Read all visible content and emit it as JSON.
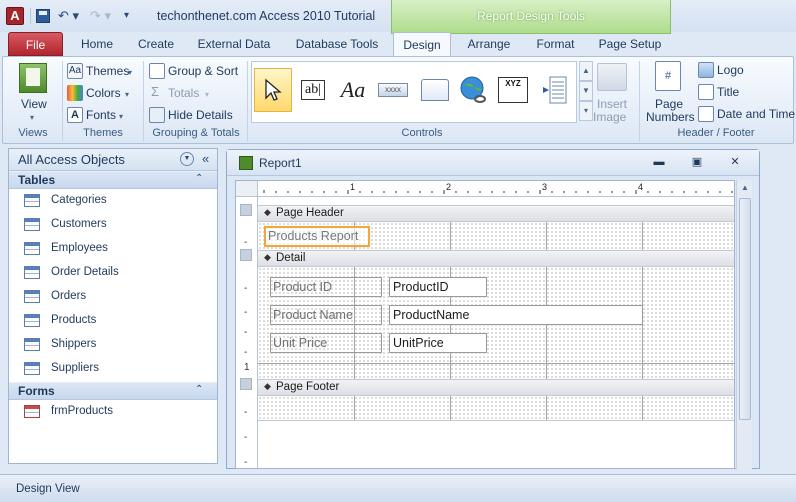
{
  "window": {
    "title": "techonthenet.com Access 2010 Tutorial",
    "app_icon": "A"
  },
  "context_tab": {
    "title": "Report Design Tools"
  },
  "tabs": [
    "File",
    "Home",
    "Create",
    "External Data",
    "Database Tools",
    "Design",
    "Arrange",
    "Format",
    "Page Setup"
  ],
  "ribbon": {
    "views": {
      "button": "View",
      "label": "Views"
    },
    "themes": {
      "themes": "Themes",
      "colors": "Colors",
      "fonts": "Fonts",
      "label": "Themes"
    },
    "grouping": {
      "group_sort": "Group & Sort",
      "totals": "Totals",
      "hide_details": "Hide Details",
      "label": "Grouping & Totals"
    },
    "controls": {
      "label": "Controls",
      "textbox_glyph": "ab|",
      "label_glyph": "Aa",
      "button_glyph": "xxxx",
      "option_glyph": "XYZ"
    },
    "insert_image": {
      "line1": "Insert",
      "line2": "Image"
    },
    "header_footer": {
      "page_numbers_1": "Page",
      "page_numbers_2": "Numbers",
      "page_numbers_glyph": "#",
      "logo": "Logo",
      "title": "Title",
      "date_time": "Date and Time",
      "label": "Header / Footer"
    }
  },
  "nav": {
    "title": "All Access Objects",
    "tables_header": "Tables",
    "tables": [
      "Categories",
      "Customers",
      "Employees",
      "Order Details",
      "Orders",
      "Products",
      "Shippers",
      "Suppliers"
    ],
    "forms_header": "Forms",
    "forms": [
      "frmProducts"
    ]
  },
  "report": {
    "title": "Report1",
    "ruler_numbers": [
      "1",
      "2",
      "3",
      "4"
    ],
    "page_header": "Page Header",
    "title_control": "Products Report",
    "detail": "Detail",
    "fields": [
      {
        "label": "Product ID",
        "box": "ProductID"
      },
      {
        "label": "Product Name",
        "box": "ProductName"
      },
      {
        "label": "Unit Price",
        "box": "UnitPrice"
      }
    ],
    "vertical_ruler_mark": "1",
    "page_footer": "Page Footer"
  },
  "status": {
    "text": "Design View"
  },
  "colors": {
    "file_tab": "#b1252e",
    "context_green": "#aedc8c",
    "selection_orange": "#f5a53a"
  },
  "icons": [
    "access-app-icon",
    "save-icon",
    "undo-icon",
    "redo-icon",
    "view-icon",
    "themes-icon",
    "colors-icon",
    "fonts-icon",
    "group-sort-icon",
    "totals-icon",
    "hide-details-icon",
    "select-pointer-icon",
    "textbox-icon",
    "label-icon",
    "button-icon",
    "tab-control-icon",
    "hyperlink-icon",
    "option-group-icon",
    "page-break-icon",
    "insert-image-icon",
    "page-numbers-icon",
    "logo-icon",
    "title-icon",
    "date-time-icon",
    "table-icon",
    "form-icon"
  ]
}
